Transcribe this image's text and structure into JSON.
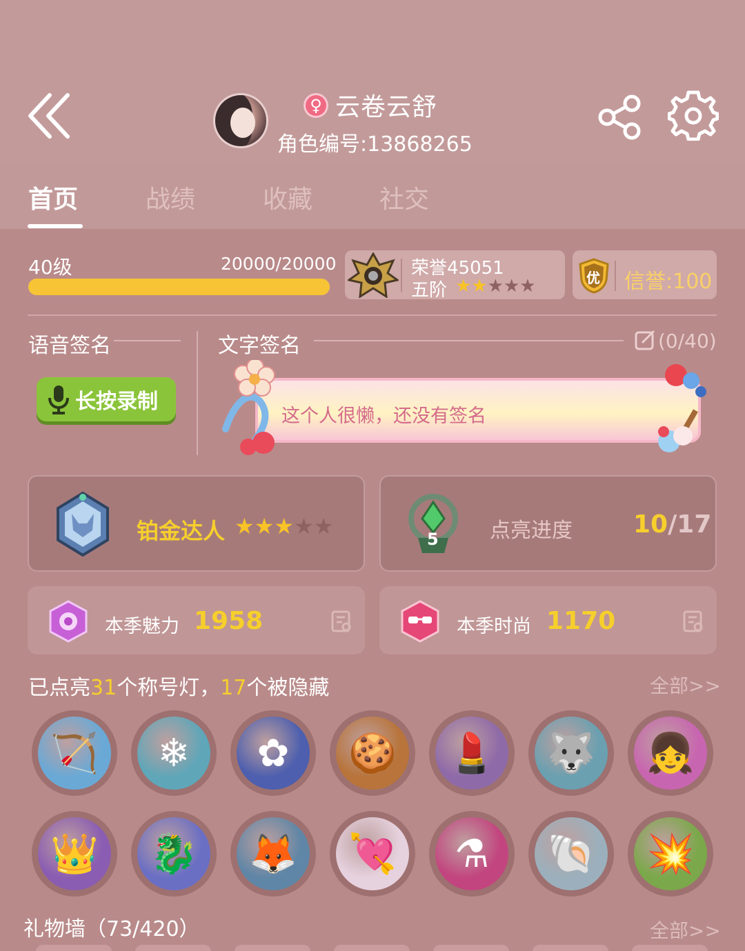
{
  "header": {
    "nickname": "云卷云舒",
    "role_id": "角色编号:13868265",
    "gender_icon": "female-icon"
  },
  "tabs": [
    {
      "label": "首页",
      "active": true
    },
    {
      "label": "战绩",
      "active": false
    },
    {
      "label": "收藏",
      "active": false
    },
    {
      "label": "社交",
      "active": false
    }
  ],
  "level": {
    "label": "40级",
    "exp_text": "20000/20000",
    "progress": 1.0
  },
  "honor": {
    "label": "荣誉45051",
    "rank": "五阶",
    "stars_on": 2,
    "stars_total": 5
  },
  "credit": {
    "badge": "优",
    "text": "信誉:100"
  },
  "signature": {
    "voice_title": "语音签名",
    "record_label": "长按录制",
    "text_title": "文字签名",
    "char_count": "(0/40)",
    "text": "这个人很懒，还没有签名"
  },
  "badges": {
    "platinum_label": "铂金达人",
    "platinum_stars_on": 3,
    "platinum_stars_total": 5,
    "light_badge_level": "5",
    "light_label": "点亮进度",
    "light_current": "10",
    "light_sep": "/",
    "light_total": "17"
  },
  "stats": {
    "charm_label": "本季魅力",
    "charm_value": "1958",
    "fashion_label": "本季时尚",
    "fashion_value": "1170"
  },
  "titles": {
    "prefix": "已点亮",
    "lit_count": "31",
    "middle": "个称号灯，",
    "hidden_count": "17",
    "suffix": "个被隐藏",
    "view_all": "全部>>",
    "icons": [
      "crossbow-icon",
      "ice-crystal-icon",
      "purple-flower-icon",
      "gingerbread-icon",
      "lipstick-icon",
      "wolf-icon",
      "anime-girl-icon",
      "crown-icon",
      "purple-dragon-icon",
      "ice-fox-icon",
      "heart-arrow-icon",
      "golden-potion-icon",
      "shell-icon",
      "golden-cannon-icon"
    ]
  },
  "gift_wall": {
    "title": "礼物墙（73/420）",
    "view_all": "全部>>"
  },
  "colors": {
    "accent_yellow": "#f6cf2c",
    "exp_bar": "#f6c434",
    "record_green": "#8ac43a"
  }
}
